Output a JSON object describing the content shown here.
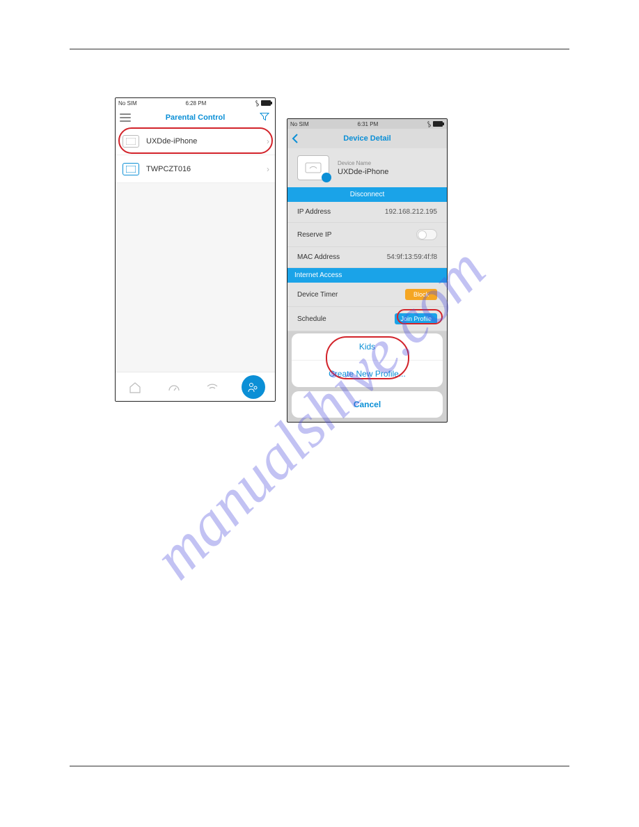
{
  "watermark": "manualshive.com",
  "left": {
    "status": {
      "carrier": "No SIM",
      "time": "6:28 PM"
    },
    "title": "Parental Control",
    "devices": [
      {
        "name": "UXDde-iPhone"
      },
      {
        "name": "TWPCZT016"
      }
    ]
  },
  "right": {
    "status": {
      "carrier": "No SIM",
      "time": "6:31 PM"
    },
    "title": "Device Detail",
    "deviceNameLabel": "Device Name",
    "deviceName": "UXDde-iPhone",
    "disconnect": "Disconnect",
    "rows": {
      "ip": {
        "label": "IP Address",
        "value": "192.168.212.195"
      },
      "reserve": {
        "label": "Reserve IP"
      },
      "mac": {
        "label": "MAC Address",
        "value": "54:9f:13:59:4f:f8"
      }
    },
    "internetAccess": "Internet Access",
    "timer": {
      "label": "Device Timer",
      "btn": "Block"
    },
    "schedule": {
      "label": "Schedule",
      "btn": "Join Profile"
    },
    "sheet": {
      "opt1": "Kids",
      "opt2": "Create New Profile...",
      "cancel": "Cancel"
    }
  }
}
